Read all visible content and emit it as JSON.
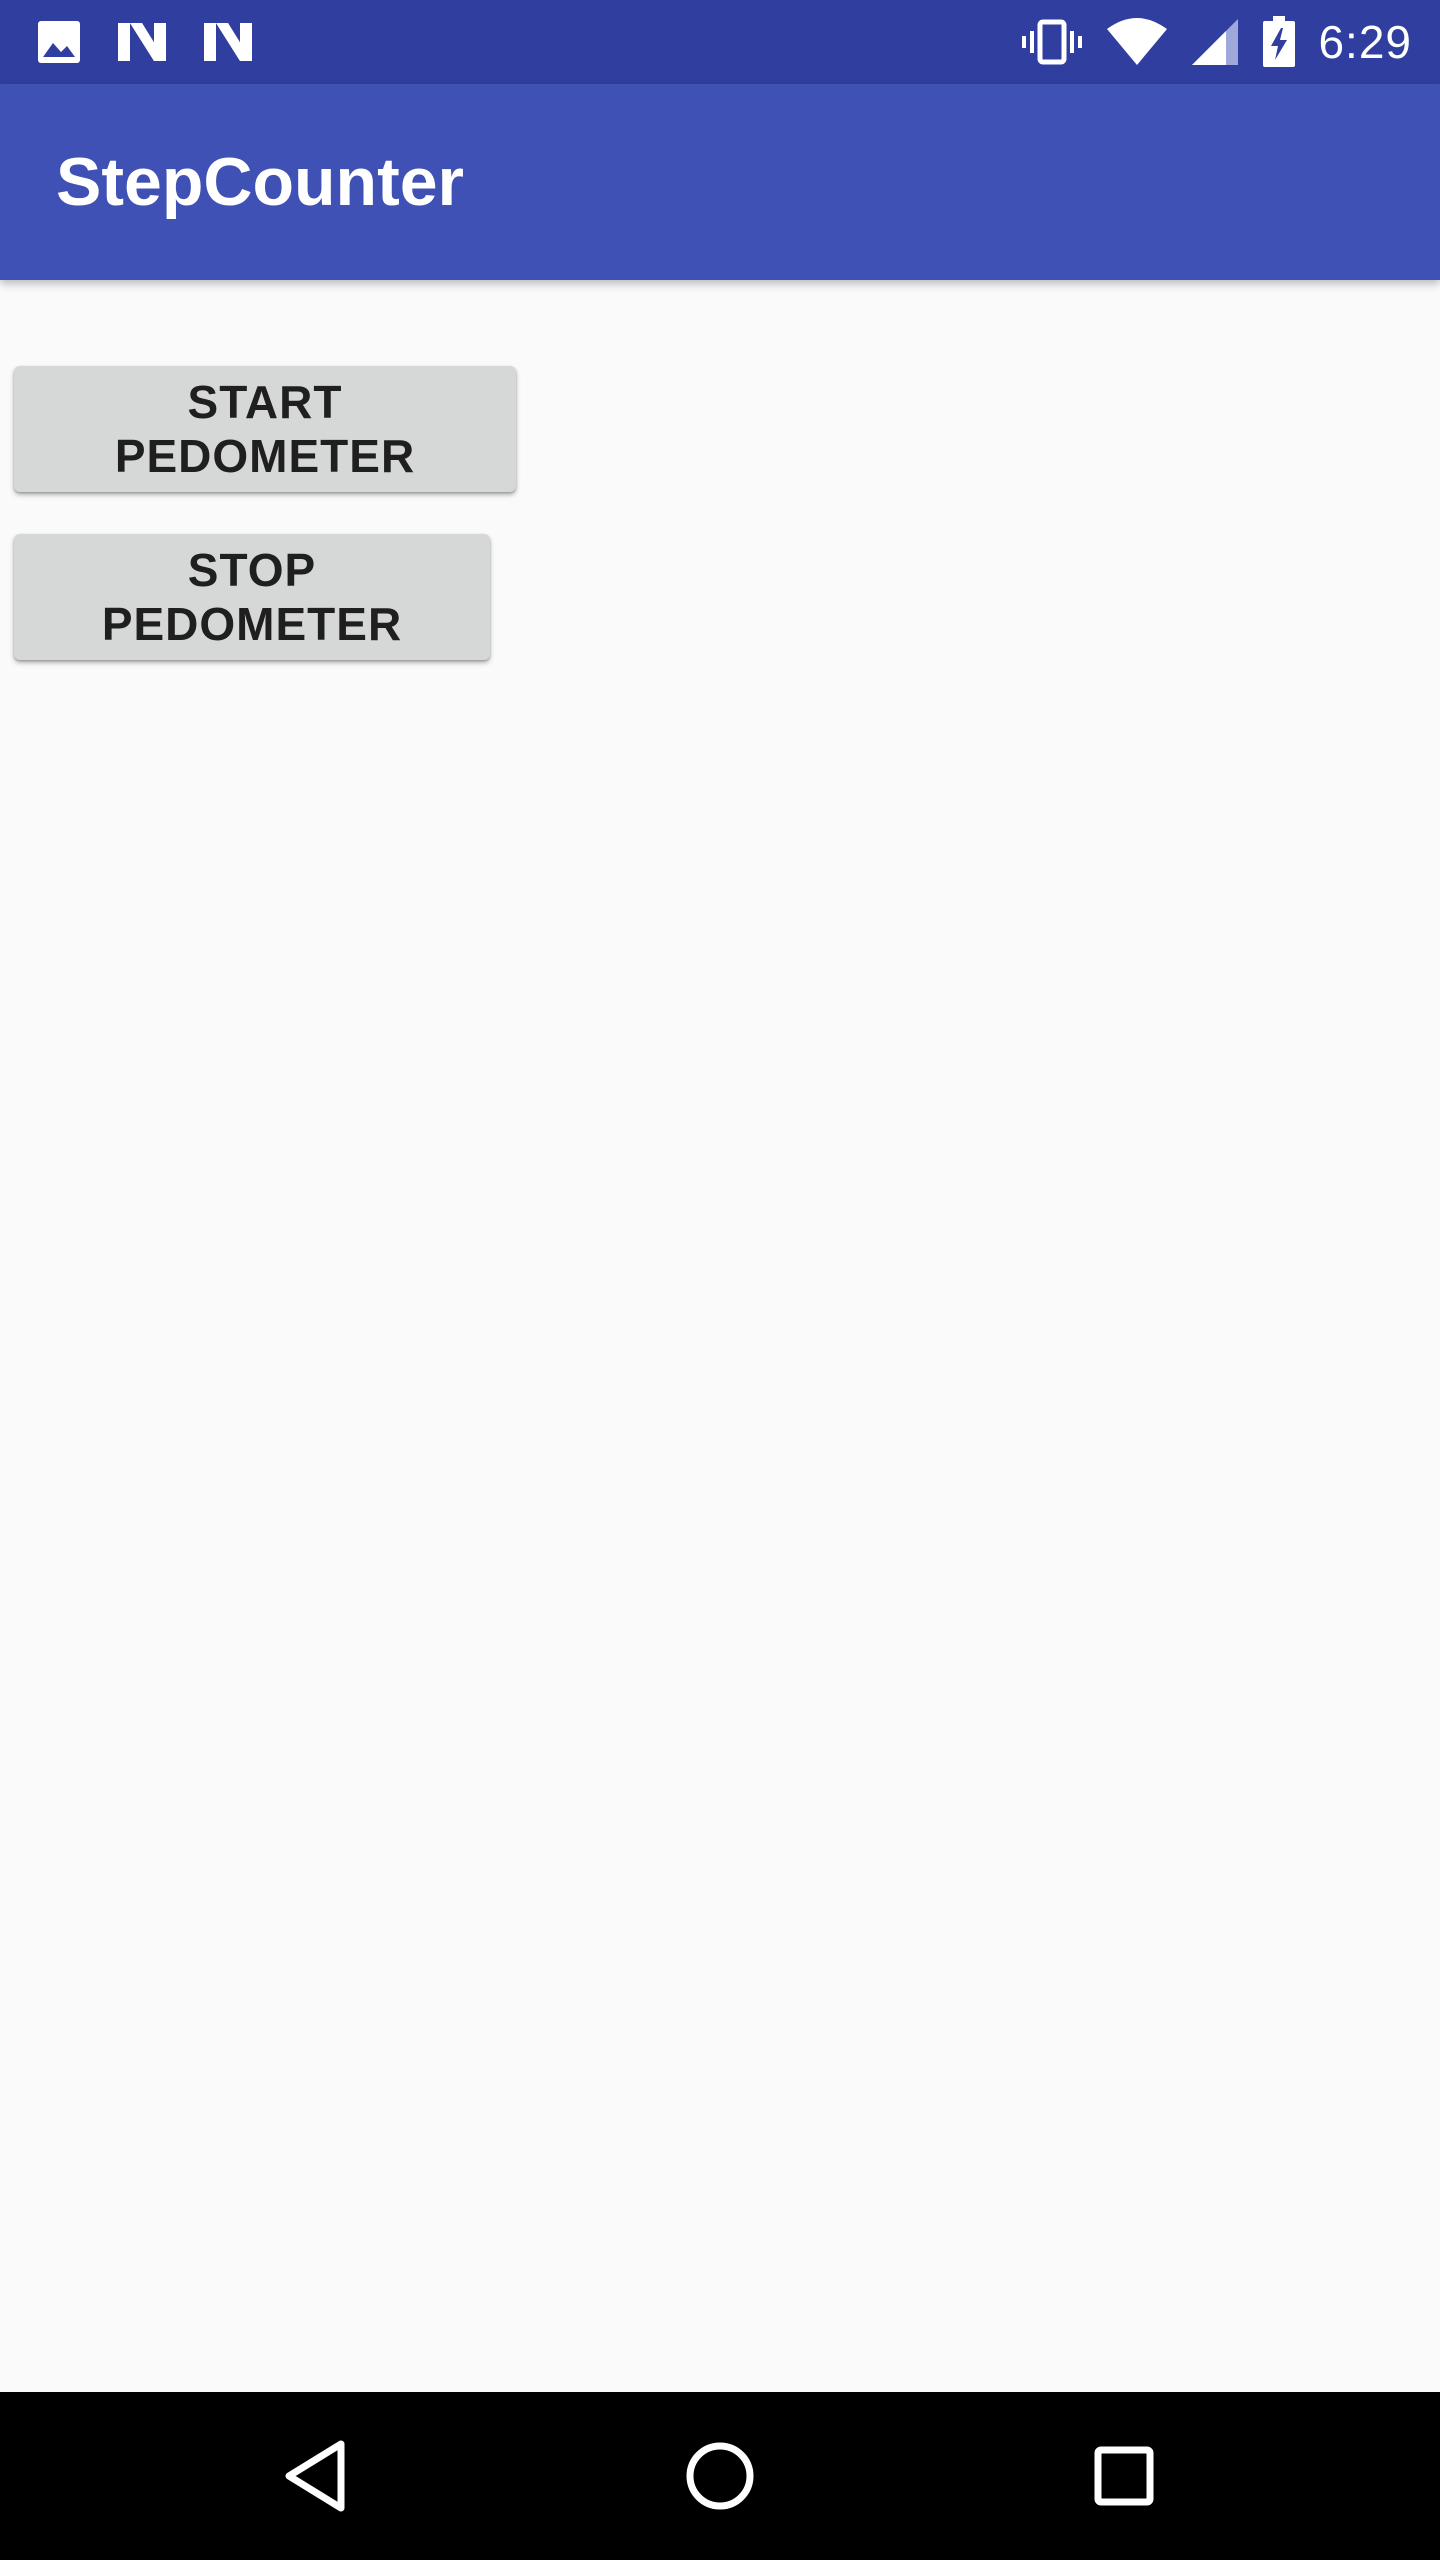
{
  "status_bar": {
    "time": "6:29",
    "left_icons": [
      "image-icon",
      "n-logo-icon",
      "n-logo-icon"
    ],
    "right_icons": [
      "vibrate-icon",
      "wifi-icon",
      "cell-signal-icon",
      "battery-charging-icon"
    ],
    "background_color": "#303f9f"
  },
  "app_bar": {
    "title": "StepCounter",
    "background_color": "#3f51b5"
  },
  "main": {
    "start_button_label": "START PEDOMETER",
    "stop_button_label": "STOP PEDOMETER"
  },
  "nav_bar": {
    "icons": [
      "back-icon",
      "home-icon",
      "recents-icon"
    ]
  }
}
